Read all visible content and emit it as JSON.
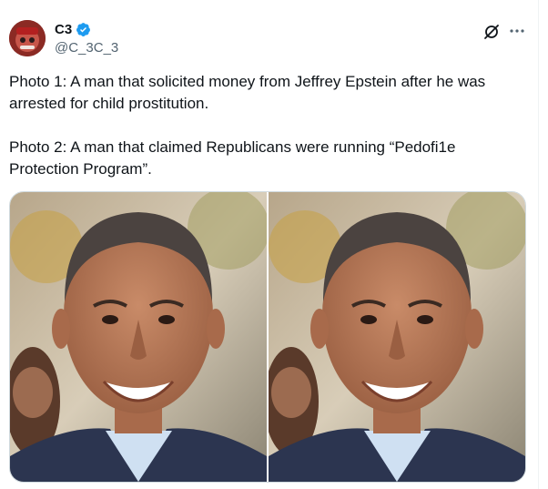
{
  "author": {
    "display_name": "C3",
    "handle": "@C_3C_3",
    "verified": true,
    "avatar": "avatar-image"
  },
  "header_icons": [
    "grok-icon",
    "more-options-icon"
  ],
  "tweet": {
    "paragraph1": "Photo 1: A man that solicited money from Jeffrey Epstein after he was arrested for child prostitution.",
    "paragraph2": "Photo 2: A man that claimed Republicans were running “Pedofi1e Protection Program”."
  },
  "media": {
    "photos": [
      {
        "id": "photo-1"
      },
      {
        "id": "photo-2"
      }
    ]
  },
  "colors": {
    "text": "#0f1419",
    "secondary": "#536471",
    "verified_blue": "#1d9bf0",
    "border": "#cfd9de"
  }
}
